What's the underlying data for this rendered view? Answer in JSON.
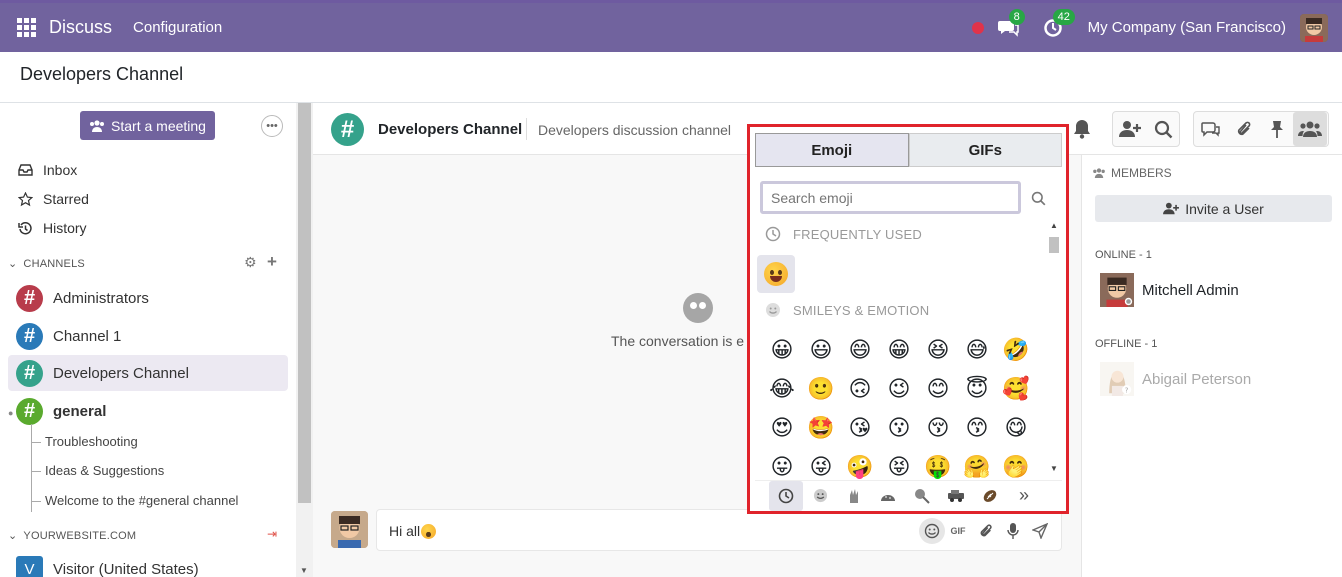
{
  "navbar": {
    "app_name": "Discuss",
    "menu_config": "Configuration",
    "chat_badge": "8",
    "activity_badge": "42",
    "company": "My Company (San Francisco)"
  },
  "control_panel": {
    "title": "Developers Channel"
  },
  "sidebar": {
    "meeting_label": "Start a meeting",
    "nav": [
      {
        "label": "Inbox",
        "icon": "inbox-icon"
      },
      {
        "label": "Starred",
        "icon": "star-icon"
      },
      {
        "label": "History",
        "icon": "history-icon"
      }
    ],
    "channels_header": "CHANNELS",
    "channels": [
      {
        "label": "Administrators",
        "color": "#b83c4b"
      },
      {
        "label": "Channel 1",
        "color": "#2a7ab8"
      },
      {
        "label": "Developers Channel",
        "color": "#35a28b"
      },
      {
        "label": "general",
        "color": "#5aaa2e"
      }
    ],
    "subchannels": [
      "Troubleshooting",
      "Ideas & Suggestions",
      "Welcome to the #general channel"
    ],
    "website_header": "YOURWEBSITE.COM",
    "visitor": {
      "initial": "V",
      "label": "Visitor (United States)"
    }
  },
  "thread": {
    "name": "Developers Channel",
    "description": "Developers discussion channel",
    "empty_text": "The conversation is e",
    "composer_text": "Hi all",
    "gif_label": "GIF"
  },
  "members": {
    "title": "MEMBERS",
    "invite_label": "Invite a User",
    "online_header": "ONLINE - 1",
    "online": [
      "Mitchell Admin"
    ],
    "offline_header": "OFFLINE - 1",
    "offline": [
      "Abigail Peterson"
    ]
  },
  "emoji_picker": {
    "tabs": [
      "Emoji",
      "GIFs"
    ],
    "search_placeholder": "Search emoji",
    "frequently_used": "FREQUENTLY USED",
    "smileys": "SMILEYS & EMOTION",
    "emojis": [
      "😀",
      "😃",
      "😄",
      "😁",
      "😆",
      "😅",
      "🤣",
      "😂",
      "🙂",
      "🙃",
      "😉",
      "😊",
      "😇",
      "🥰",
      "😍",
      "🤩",
      "😘",
      "😗",
      "😚",
      "😙",
      "😋",
      "😛",
      "😜",
      "🤪",
      "😝",
      "🤑",
      "🤗",
      "🤭"
    ],
    "highlight_color": "#e0232b"
  }
}
